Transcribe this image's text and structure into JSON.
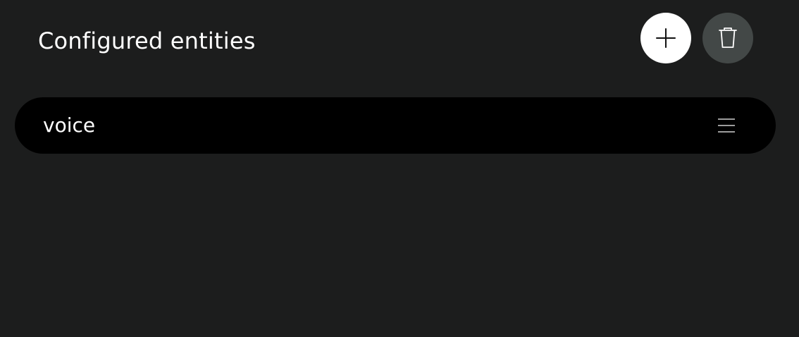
{
  "header": {
    "title": "Configured entities"
  },
  "actions": {
    "add": {
      "icon": "plus-icon"
    },
    "delete": {
      "icon": "trash-icon"
    }
  },
  "entities": [
    {
      "label": "voice",
      "handle_icon": "drag-handle-icon"
    }
  ],
  "colors": {
    "background": "#1c1d1d",
    "item_background": "#000000",
    "add_button": "#ffffff",
    "delete_button": "#434847",
    "text": "#ffffff"
  }
}
